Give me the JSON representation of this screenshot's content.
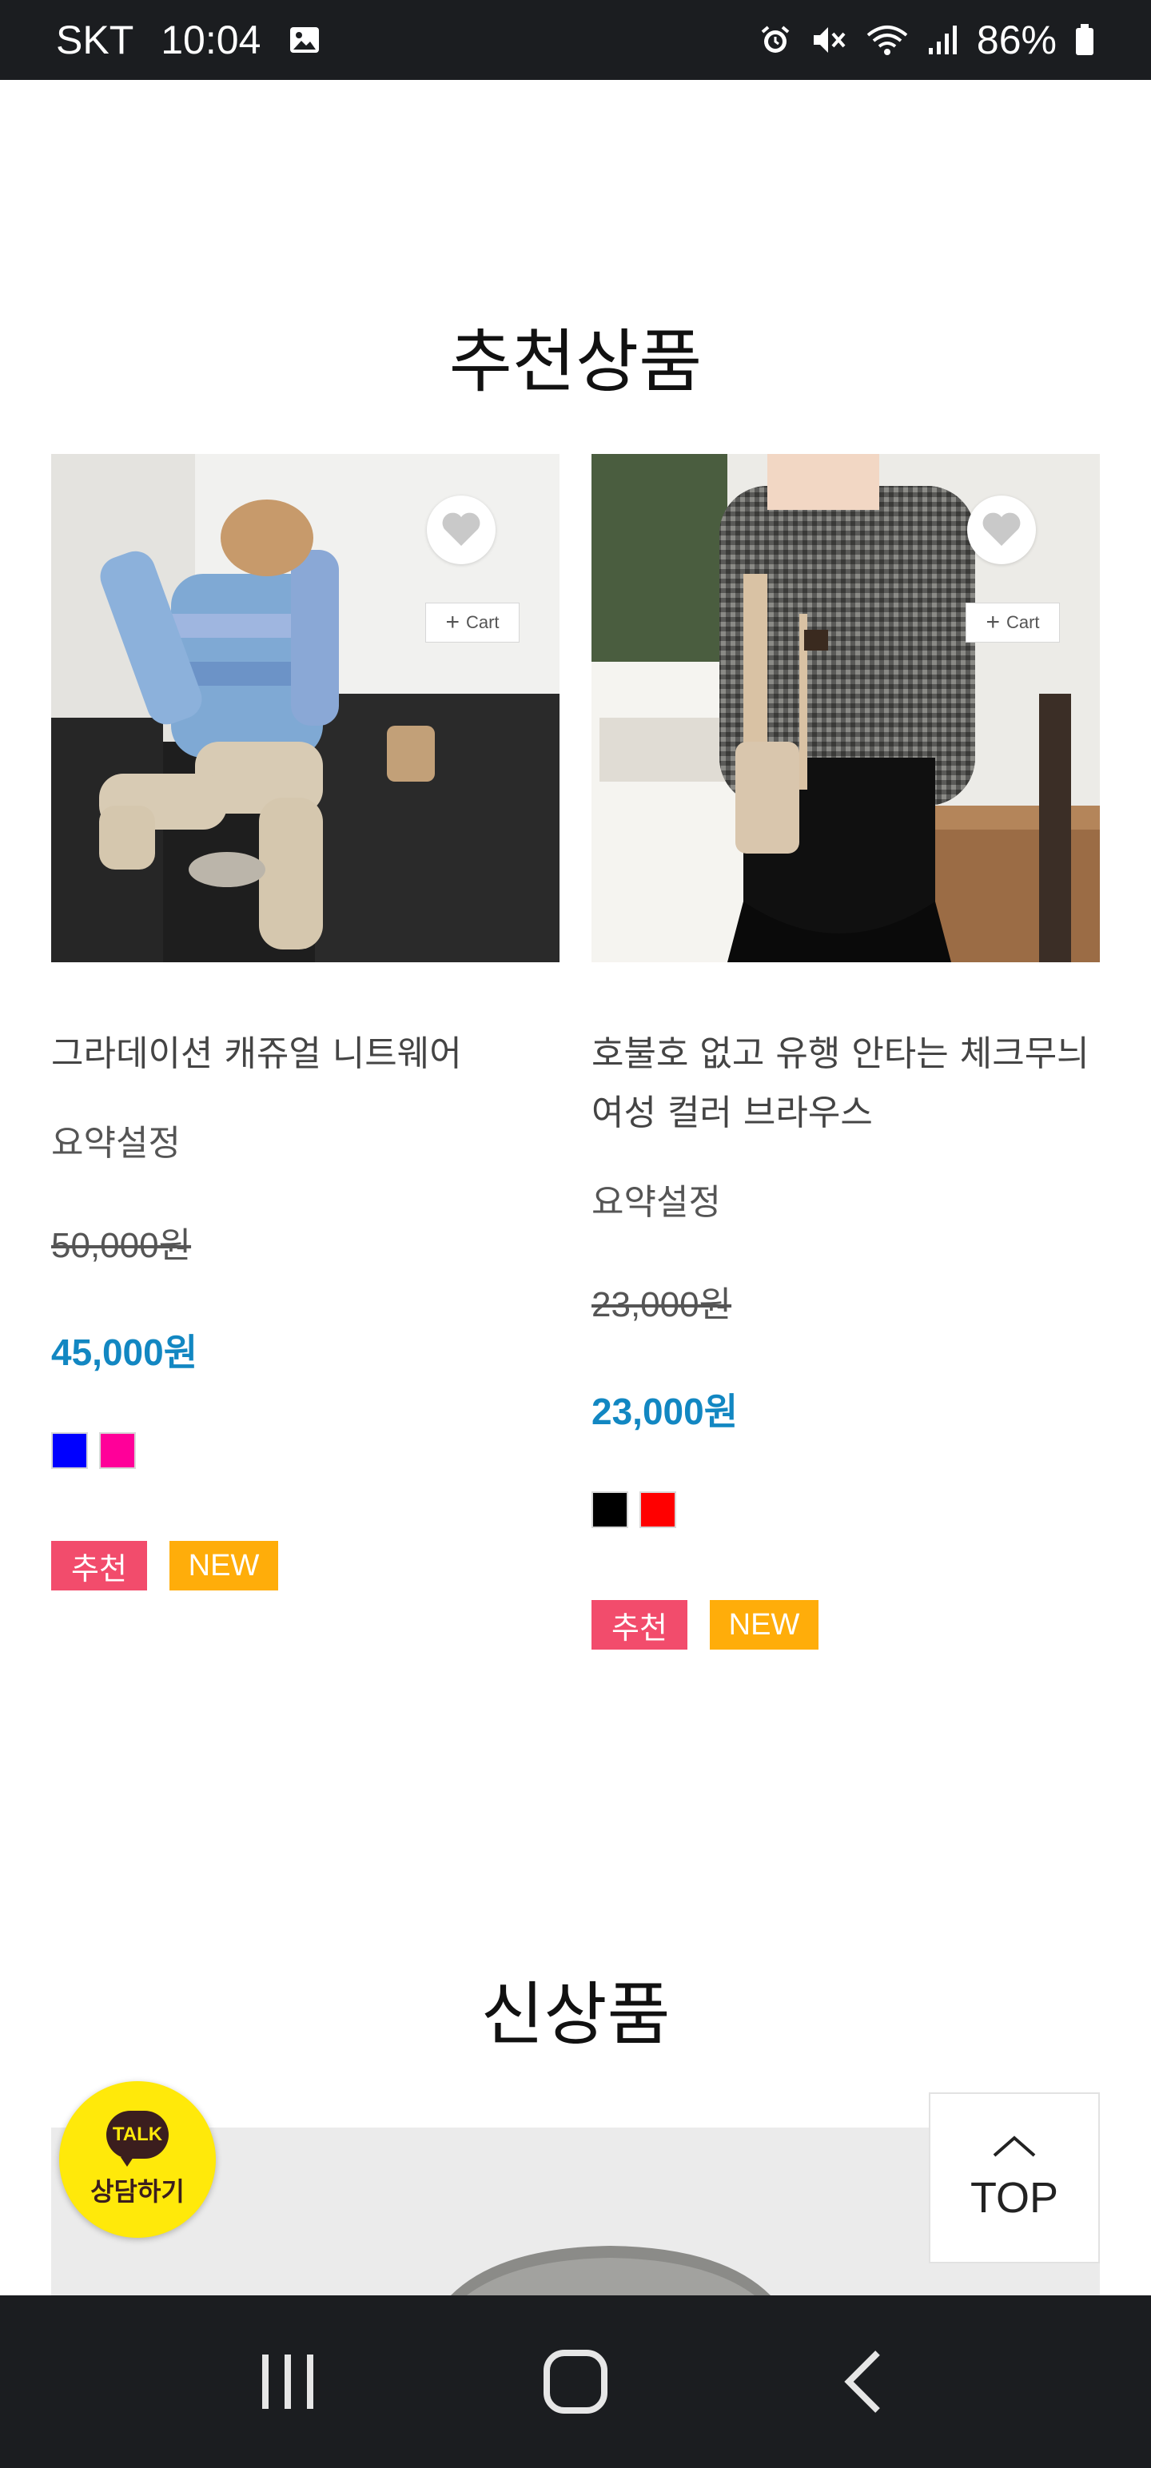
{
  "status_bar": {
    "carrier": "SKT",
    "time": "10:04",
    "battery": "86%",
    "icons": [
      "image-icon",
      "alarm-icon",
      "mute-icon",
      "wifi-icon",
      "signal-icon",
      "battery-icon"
    ]
  },
  "sections": {
    "recommended_title": "추천상품",
    "new_title": "신상품"
  },
  "products": [
    {
      "name": "그라데이션 캐쥬얼 니트웨어",
      "summary": "요약설정",
      "price_original": "50,000원",
      "price_sale": "45,000원",
      "colors": [
        "#0000ff",
        "#ff0099"
      ],
      "badges": [
        "추천",
        "NEW"
      ]
    },
    {
      "name": "호불호 없고 유행 안타는 체크무늬 여성 컬러 브라우스",
      "summary": "요약설정",
      "price_original": "23,000원",
      "price_sale": "23,000원",
      "colors": [
        "#000000",
        "#ff0000"
      ],
      "badges": [
        "추천",
        "NEW"
      ]
    }
  ],
  "cart_label": "Cart",
  "talk": {
    "bubble": "TALK",
    "label": "상담하기"
  },
  "top_button": {
    "label": "TOP"
  },
  "colors": {
    "sale_price": "#1287c2",
    "badge_recommend": "#f24c6c",
    "badge_new": "#ffad0a",
    "talk_yellow": "#ffe90a"
  }
}
